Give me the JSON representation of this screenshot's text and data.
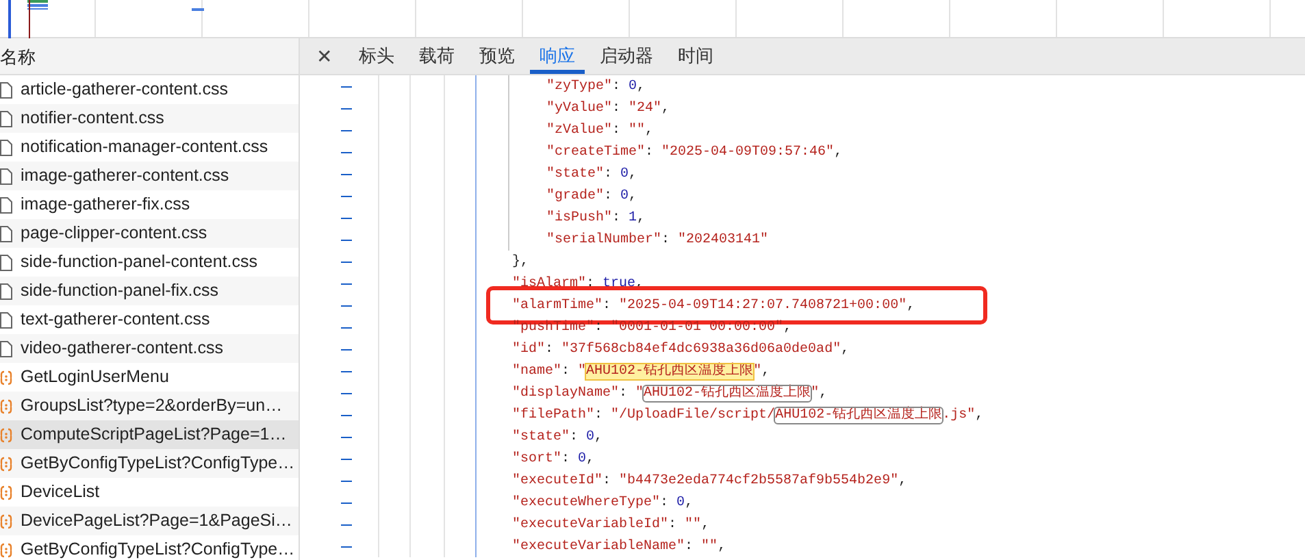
{
  "list_header": "名称",
  "requests": [
    {
      "name": "article-gatherer-content.css",
      "kind": "stylesheet",
      "selected": false
    },
    {
      "name": "notifier-content.css",
      "kind": "stylesheet",
      "selected": false
    },
    {
      "name": "notification-manager-content.css",
      "kind": "stylesheet",
      "selected": false
    },
    {
      "name": "image-gatherer-content.css",
      "kind": "stylesheet",
      "selected": false
    },
    {
      "name": "image-gatherer-fix.css",
      "kind": "stylesheet",
      "selected": false
    },
    {
      "name": "page-clipper-content.css",
      "kind": "stylesheet",
      "selected": false
    },
    {
      "name": "side-function-panel-content.css",
      "kind": "stylesheet",
      "selected": false
    },
    {
      "name": "side-function-panel-fix.css",
      "kind": "stylesheet",
      "selected": false
    },
    {
      "name": "text-gatherer-content.css",
      "kind": "stylesheet",
      "selected": false
    },
    {
      "name": "video-gatherer-content.css",
      "kind": "stylesheet",
      "selected": false
    },
    {
      "name": "GetLoginUserMenu",
      "kind": "fetch",
      "selected": false
    },
    {
      "name": "GroupsList?type=2&orderBy=un…",
      "kind": "fetch",
      "selected": false
    },
    {
      "name": "ComputeScriptPageList?Page=1…",
      "kind": "fetch",
      "selected": true
    },
    {
      "name": "GetByConfigTypeList?ConfigType…",
      "kind": "fetch",
      "selected": false
    },
    {
      "name": "DeviceList",
      "kind": "fetch",
      "selected": false
    },
    {
      "name": "DevicePageList?Page=1&PageSi…",
      "kind": "fetch",
      "selected": false
    },
    {
      "name": "GetByConfigTypeList?ConfigType…",
      "kind": "fetch",
      "selected": false
    }
  ],
  "close_button": "✕",
  "detail_tabs": [
    {
      "label": "标头",
      "selected": false
    },
    {
      "label": "载荷",
      "selected": false
    },
    {
      "label": "预览",
      "selected": false
    },
    {
      "label": "响应",
      "selected": true
    },
    {
      "label": "启动器",
      "selected": false
    },
    {
      "label": "时间",
      "selected": false
    }
  ],
  "response_lines": [
    {
      "children": [
        {
          "segments": [
            {
              "text": "\"zyType\"",
              "kind": "key"
            },
            {
              "text": ": ",
              "kind": "punct"
            },
            {
              "text": "0",
              "kind": "number"
            },
            {
              "text": ",",
              "kind": "punct"
            }
          ]
        },
        {
          "segments": [
            {
              "text": "\"yValue\"",
              "kind": "key"
            },
            {
              "text": ": ",
              "kind": "punct"
            },
            {
              "text": "\"24\"",
              "kind": "string"
            },
            {
              "text": ",",
              "kind": "punct"
            }
          ]
        },
        {
          "segments": [
            {
              "text": "\"zValue\"",
              "kind": "key"
            },
            {
              "text": ": ",
              "kind": "punct"
            },
            {
              "text": "\"\"",
              "kind": "string"
            },
            {
              "text": ",",
              "kind": "punct"
            }
          ]
        },
        {
          "segments": [
            {
              "text": "\"createTime\"",
              "kind": "key"
            },
            {
              "text": ": ",
              "kind": "punct"
            },
            {
              "text": "\"2025-04-09T09:57:46\"",
              "kind": "string"
            },
            {
              "text": ",",
              "kind": "punct"
            }
          ]
        },
        {
          "segments": [
            {
              "text": "\"state\"",
              "kind": "key"
            },
            {
              "text": ": ",
              "kind": "punct"
            },
            {
              "text": "0",
              "kind": "number"
            },
            {
              "text": ",",
              "kind": "punct"
            }
          ]
        },
        {
          "segments": [
            {
              "text": "\"grade\"",
              "kind": "key"
            },
            {
              "text": ": ",
              "kind": "punct"
            },
            {
              "text": "0",
              "kind": "number"
            },
            {
              "text": ",",
              "kind": "punct"
            }
          ]
        },
        {
          "segments": [
            {
              "text": "\"isPush\"",
              "kind": "key"
            },
            {
              "text": ": ",
              "kind": "punct"
            },
            {
              "text": "1",
              "kind": "number"
            },
            {
              "text": ",",
              "kind": "punct"
            }
          ]
        },
        {
          "segments": [
            {
              "text": "\"serialNumber\"",
              "kind": "key"
            },
            {
              "text": ": ",
              "kind": "punct"
            },
            {
              "text": "\"202403141\"",
              "kind": "string"
            }
          ]
        }
      ]
    },
    {
      "segments": [
        {
          "text": "},",
          "kind": "punct"
        }
      ]
    },
    {
      "segments": [
        {
          "text": "\"isAlarm\"",
          "kind": "key"
        },
        {
          "text": ": ",
          "kind": "punct"
        },
        {
          "text": "true",
          "kind": "number"
        },
        {
          "text": ",",
          "kind": "punct"
        }
      ]
    },
    {
      "boxed": true,
      "segments": [
        {
          "text": "\"alarmTime\"",
          "kind": "key"
        },
        {
          "text": ": ",
          "kind": "punct"
        },
        {
          "text": "\"2025-04-09T14:27:07.7408721+00:00\"",
          "kind": "string"
        },
        {
          "text": ",",
          "kind": "punct"
        }
      ]
    },
    {
      "segments": [
        {
          "text": "\"pushTime\"",
          "kind": "key"
        },
        {
          "text": ": ",
          "kind": "punct"
        },
        {
          "text": "\"0001-01-01 00:00:00\"",
          "kind": "string"
        },
        {
          "text": ",",
          "kind": "punct"
        }
      ]
    },
    {
      "segments": [
        {
          "text": "\"id\"",
          "kind": "key"
        },
        {
          "text": ": ",
          "kind": "punct"
        },
        {
          "text": "\"37f568cb84ef4dc6938a36d06a0de0ad\"",
          "kind": "string"
        },
        {
          "text": ",",
          "kind": "punct"
        }
      ]
    },
    {
      "segments": [
        {
          "text": "\"name\"",
          "kind": "key"
        },
        {
          "text": ": ",
          "kind": "punct"
        },
        {
          "text": "\"",
          "kind": "string"
        },
        {
          "text": "AHU102-钻孔西区温度上限",
          "kind": "highlight"
        },
        {
          "text": "\"",
          "kind": "string"
        },
        {
          "text": ",",
          "kind": "punct"
        }
      ]
    },
    {
      "segments": [
        {
          "text": "\"displayName\"",
          "kind": "key"
        },
        {
          "text": ": ",
          "kind": "punct"
        },
        {
          "text": "\"",
          "kind": "string"
        },
        {
          "text": "AHU102-钻孔西区温度上限",
          "kind": "outline"
        },
        {
          "text": "\"",
          "kind": "string"
        },
        {
          "text": ",",
          "kind": "punct"
        }
      ]
    },
    {
      "segments": [
        {
          "text": "\"filePath\"",
          "kind": "key"
        },
        {
          "text": ": ",
          "kind": "punct"
        },
        {
          "text": "\"/UploadFile/script/",
          "kind": "string"
        },
        {
          "text": "AHU102-钻孔西区温度上限",
          "kind": "outline"
        },
        {
          "text": ".js\"",
          "kind": "string"
        },
        {
          "text": ",",
          "kind": "punct"
        }
      ]
    },
    {
      "segments": [
        {
          "text": "\"state\"",
          "kind": "key"
        },
        {
          "text": ": ",
          "kind": "punct"
        },
        {
          "text": "0",
          "kind": "number"
        },
        {
          "text": ",",
          "kind": "punct"
        }
      ]
    },
    {
      "segments": [
        {
          "text": "\"sort\"",
          "kind": "key"
        },
        {
          "text": ": ",
          "kind": "punct"
        },
        {
          "text": "0",
          "kind": "number"
        },
        {
          "text": ",",
          "kind": "punct"
        }
      ]
    },
    {
      "segments": [
        {
          "text": "\"executeId\"",
          "kind": "key"
        },
        {
          "text": ": ",
          "kind": "punct"
        },
        {
          "text": "\"b4473e2eda774cf2b5587af9b554b2e9\"",
          "kind": "string"
        },
        {
          "text": ",",
          "kind": "punct"
        }
      ]
    },
    {
      "segments": [
        {
          "text": "\"executeWhereType\"",
          "kind": "key"
        },
        {
          "text": ": ",
          "kind": "punct"
        },
        {
          "text": "0",
          "kind": "number"
        },
        {
          "text": ",",
          "kind": "punct"
        }
      ]
    },
    {
      "segments": [
        {
          "text": "\"executeVariableId\"",
          "kind": "key"
        },
        {
          "text": ": ",
          "kind": "punct"
        },
        {
          "text": "\"\"",
          "kind": "string"
        },
        {
          "text": ",",
          "kind": "punct"
        }
      ]
    },
    {
      "segments": [
        {
          "text": "\"executeVariableName\"",
          "kind": "key"
        },
        {
          "text": ": ",
          "kind": "punct"
        },
        {
          "text": "\"\"",
          "kind": "string"
        },
        {
          "text": ",",
          "kind": "punct"
        }
      ]
    }
  ]
}
